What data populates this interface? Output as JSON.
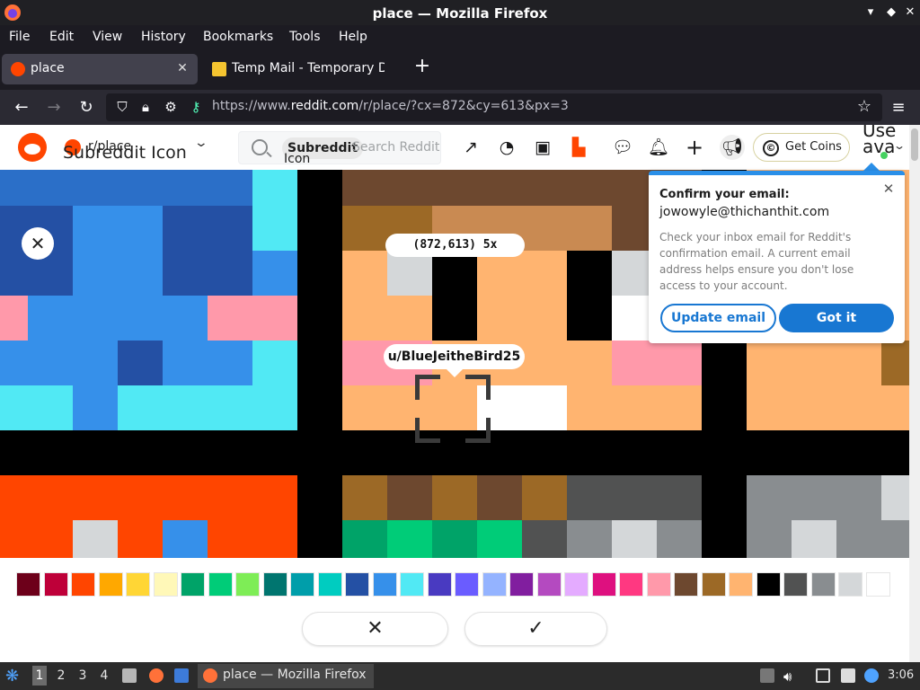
{
  "window": {
    "title": "place — Mozilla Firefox"
  },
  "menu": [
    "File",
    "Edit",
    "View",
    "History",
    "Bookmarks",
    "Tools",
    "Help"
  ],
  "tabs": [
    {
      "label": "place",
      "active": true
    },
    {
      "label": "Temp Mail - Temporary Di",
      "active": false
    }
  ],
  "url": {
    "prefix": "https://www.",
    "domain": "reddit.com",
    "suffix": "/r/place/?cx=872&cy=613&px=3"
  },
  "reddit": {
    "subreddit": "r/place",
    "subreddit_icon_alt": "Subreddit Icon",
    "search_chip": "Subreddit",
    "search_chip_alt": "Icon",
    "search_placeholder": "Search Reddit",
    "get_coins": "Get Coins",
    "user_label": "Use",
    "user_label2": "ava"
  },
  "canvas": {
    "coordinates": "(872,613) 5x",
    "pixel_user": "u/BlueJeitheBird25"
  },
  "popup": {
    "title": "Confirm your email:",
    "email": "jowowyle@thichanthit.com",
    "body": "Check your inbox email for Reddit's confirmation email. A current email address helps ensure you don't lose access to your account.",
    "update_button": "Update email",
    "got_it_button": "Got it"
  },
  "palette": [
    "#6d001a",
    "#be0039",
    "#ff4500",
    "#ffa800",
    "#ffd635",
    "#fff8b8",
    "#00a368",
    "#00cc78",
    "#7eed56",
    "#00756f",
    "#009eaa",
    "#00ccc0",
    "#2450a4",
    "#3690ea",
    "#51e9f4",
    "#493ac1",
    "#6a5cff",
    "#94b3ff",
    "#811e9f",
    "#b44ac0",
    "#e4abff",
    "#de107f",
    "#ff3881",
    "#ff99aa",
    "#6d482f",
    "#9c6926",
    "#ffb470",
    "#000000",
    "#515252",
    "#898d90",
    "#d4d7d9",
    "#ffffff"
  ],
  "taskbar": {
    "workspaces": [
      "1",
      "2",
      "3",
      "4"
    ],
    "task_label": "place — Mozilla Firefox",
    "clock": "3:06"
  }
}
